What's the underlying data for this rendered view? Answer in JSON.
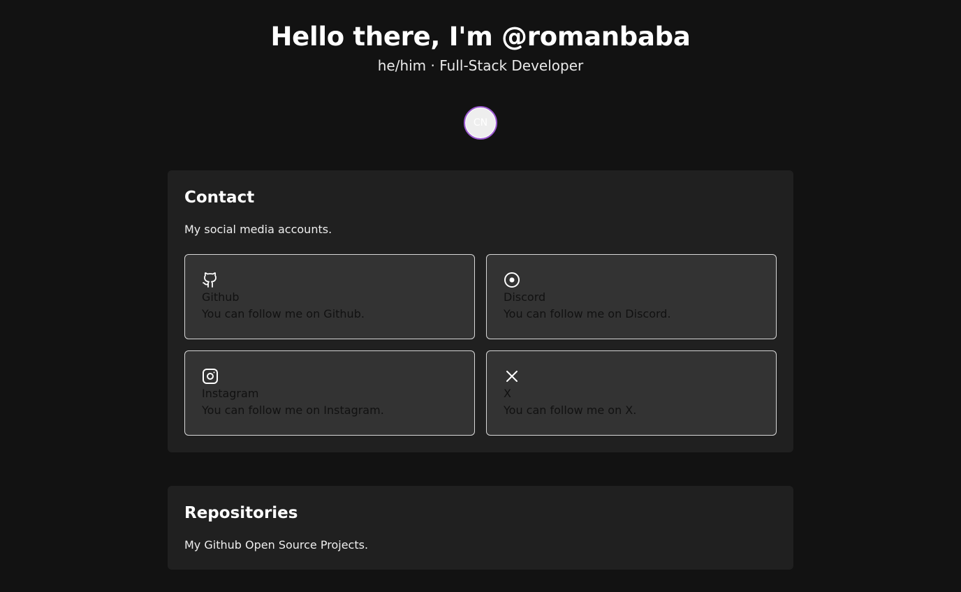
{
  "hero": {
    "title": "Hello there, I'm @romanbaba",
    "subtitle": "he/him · Full-Stack Developer",
    "avatar_initials": "CN"
  },
  "contact": {
    "title": "Contact",
    "description": "My social media accounts.",
    "links": [
      {
        "icon": "github-icon",
        "name": "Github",
        "text": "You can follow me on Github."
      },
      {
        "icon": "discord-icon",
        "name": "Discord",
        "text": "You can follow me on Discord."
      },
      {
        "icon": "instagram-icon",
        "name": "Instagram",
        "text": "You can follow me on Instagram."
      },
      {
        "icon": "x-icon",
        "name": "X",
        "text": "You can follow me on X."
      }
    ]
  },
  "repositories": {
    "title": "Repositories",
    "description": "My Github Open Source Projects."
  },
  "colors": {
    "background": "#121212",
    "card": "#202020",
    "social_card": "#333333",
    "avatar_ring": "#9b59d0"
  }
}
